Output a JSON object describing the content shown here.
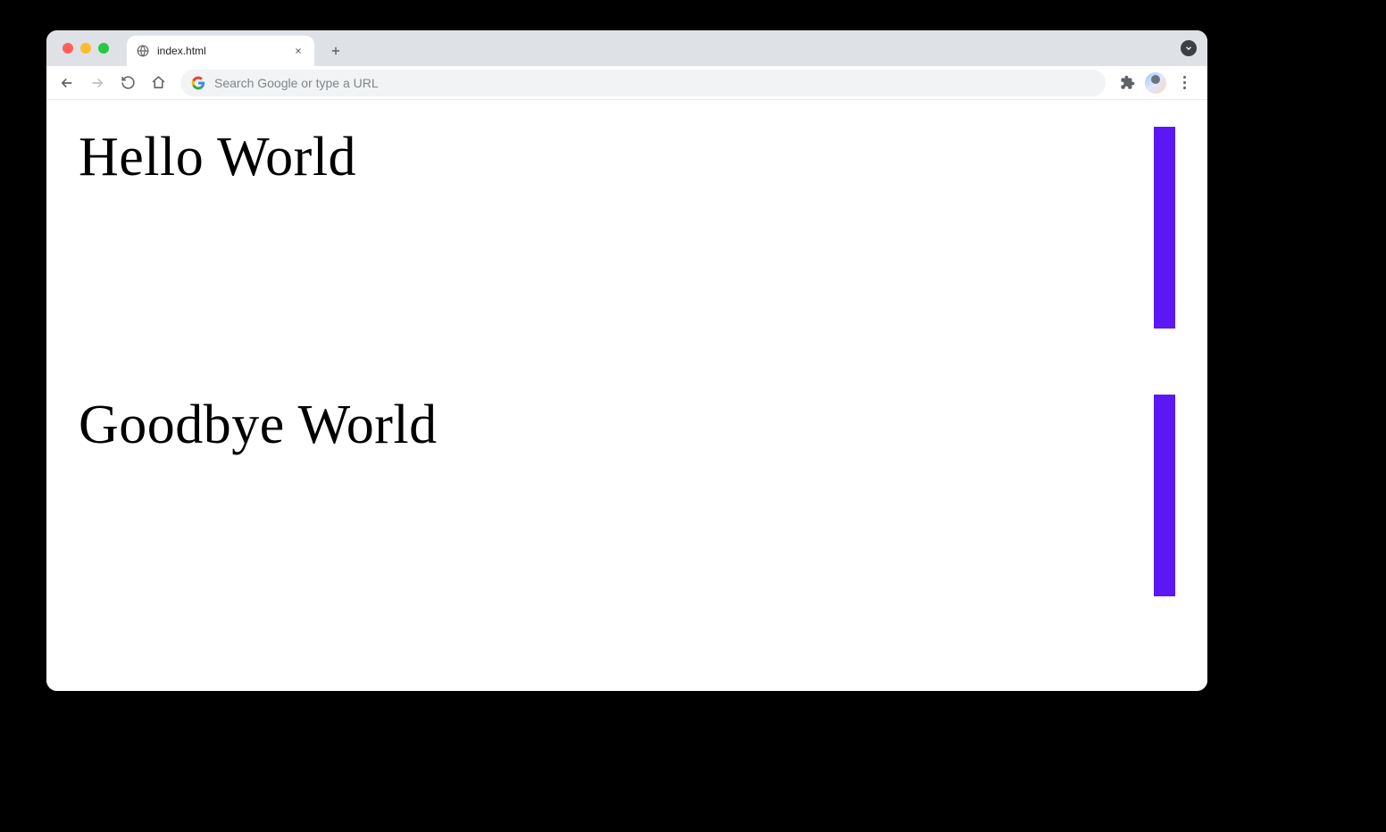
{
  "window": {
    "tab_title": "index.html",
    "address_placeholder": "Search Google or type a URL"
  },
  "page": {
    "sections": [
      {
        "heading": "Hello World"
      },
      {
        "heading": "Goodbye World"
      }
    ],
    "accent_color": "#5b18f4"
  }
}
